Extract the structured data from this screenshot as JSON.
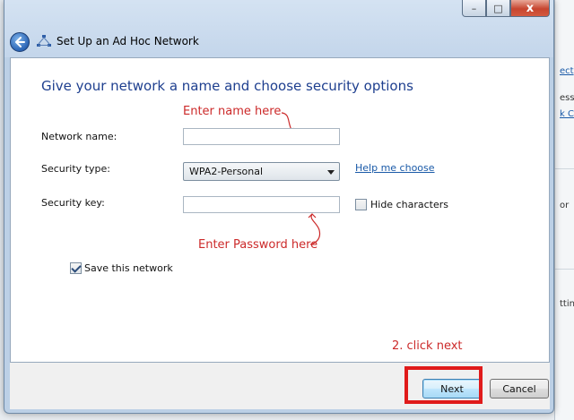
{
  "dialog": {
    "title": "Set Up an Ad Hoc Network",
    "heading": "Give your network a name and choose security options"
  },
  "form": {
    "network_name_label": "Network name:",
    "network_name_value": "",
    "security_type_label": "Security type:",
    "security_type_value": "WPA2-Personal",
    "help_link": "Help me choose",
    "security_key_label": "Security key:",
    "security_key_value": "",
    "hide_characters_label": "Hide characters",
    "hide_characters_checked": false,
    "save_network_label": "Save this network",
    "save_network_checked": true
  },
  "annotations": {
    "enter_name": "Enter name here",
    "enter_password": "Enter Password here",
    "click_next": "2. click next"
  },
  "footer": {
    "next_label": "Next",
    "cancel_label": "Cancel"
  },
  "caption": {
    "minimize": "–",
    "maximize": "□",
    "close": "x"
  },
  "right_window": {
    "lines": [
      "ect",
      "ess",
      "k C",
      "or",
      "ttin"
    ]
  },
  "colors": {
    "heading": "#1e3f8f",
    "link": "#1a5aa8",
    "annotation": "#cc2a2a",
    "highlight_box": "#e01b1b"
  },
  "icons": [
    "back-arrow-icon",
    "network-icon"
  ]
}
